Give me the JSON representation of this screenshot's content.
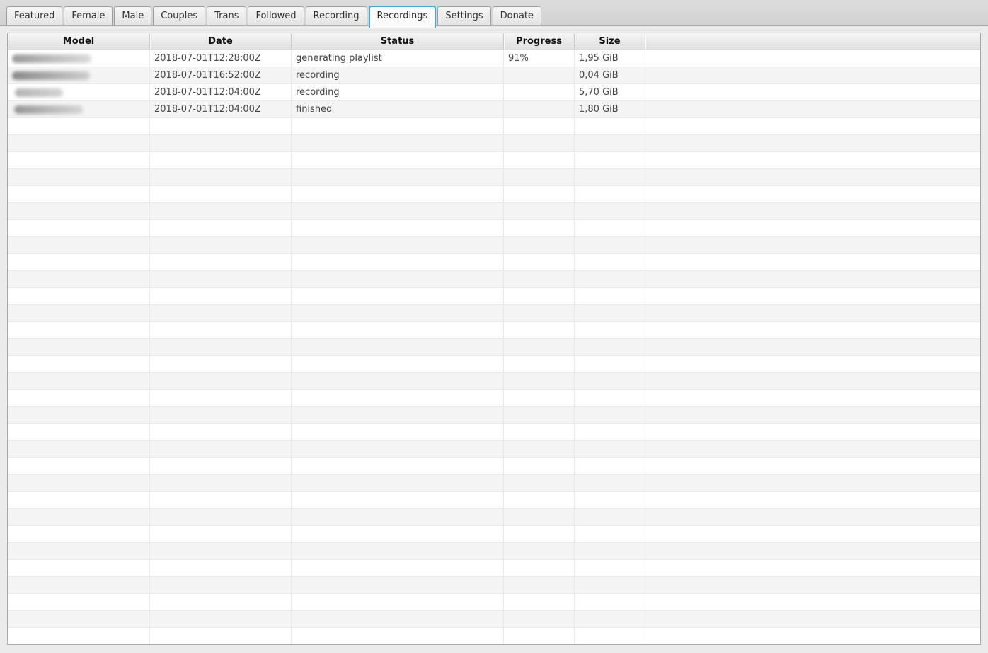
{
  "tab_bar": {
    "tabs": [
      {
        "label": "Featured",
        "active": false
      },
      {
        "label": "Female",
        "active": false
      },
      {
        "label": "Male",
        "active": false
      },
      {
        "label": "Couples",
        "active": false
      },
      {
        "label": "Trans",
        "active": false
      },
      {
        "label": "Followed",
        "active": false
      },
      {
        "label": "Recording",
        "active": false
      },
      {
        "label": "Recordings",
        "active": true
      },
      {
        "label": "Settings",
        "active": false
      },
      {
        "label": "Donate",
        "active": false
      }
    ]
  },
  "recordings_table": {
    "column_headers": [
      "Model",
      "Date",
      "Status",
      "Progress",
      "Size"
    ],
    "rows": [
      {
        "model_redacted": true,
        "date": "2018-07-01T12:28:00Z",
        "status": "generating playlist",
        "progress": "91%",
        "size": "1,95 GiB"
      },
      {
        "model_redacted": true,
        "date": "2018-07-01T16:52:00Z",
        "status": "recording",
        "progress": "",
        "size": "0,04 GiB"
      },
      {
        "model_redacted": true,
        "date": "2018-07-01T12:04:00Z",
        "status": "recording",
        "progress": "",
        "size": "5,70 GiB"
      },
      {
        "model_redacted": true,
        "date": "2018-07-01T12:04:00Z",
        "status": "finished",
        "progress": "",
        "size": "1,80 GiB"
      }
    ]
  },
  "colors": {
    "active_tab_border": "#49a4d9",
    "window_background": "#ebebeb",
    "row_stripe": "#f4f4f4"
  }
}
